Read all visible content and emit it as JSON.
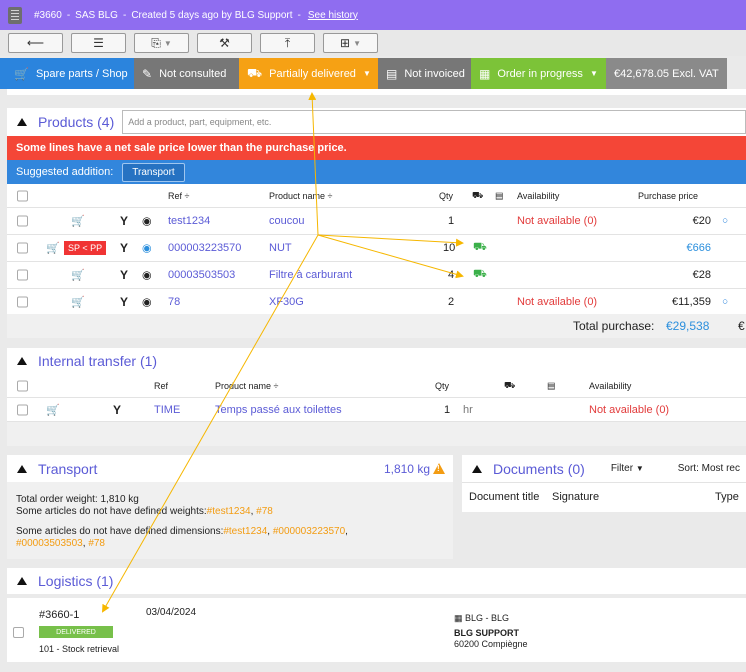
{
  "titlebar": {
    "order_id": "#3660",
    "company": "SAS BLG",
    "created": "Created 5 days ago by BLG Support",
    "history_link": "See history"
  },
  "toolbar": {
    "buttons": [
      "back-arrow",
      "list",
      "export",
      "tools",
      "upload",
      "tree"
    ]
  },
  "status": {
    "shop": "Spare parts / Shop",
    "consulted": "Not consulted",
    "delivery": "Partially delivered",
    "invoiced": "Not invoiced",
    "order_state": "Order in progress",
    "amount": "€42,678.05 Excl. VAT"
  },
  "colors": {
    "title_bar": "#8f6df0",
    "status_blue": "#2b84dd",
    "status_orange": "#f6a114",
    "status_green": "#7cc338",
    "warning_red": "#f44637",
    "link": "#5b5bd6",
    "annotation_arrow": "#f6b700"
  },
  "products": {
    "title": "Products (4)",
    "search_placeholder": "Add a product, part, equipment, etc.",
    "warning": "Some lines have a net sale price lower than the purchase price.",
    "suggested_label": "Suggested addition:",
    "suggested_button": "Transport",
    "columns": {
      "ref": "Ref ÷",
      "name": "Product name ÷",
      "qty": "Qty",
      "availability": "Availability",
      "purchase_price": "Purchase price"
    },
    "rows": [
      {
        "ref": "test1234",
        "name": "coucou",
        "qty": "1",
        "availability": "Not available (0)",
        "price": "€20"
      },
      {
        "badge": "SP < PP",
        "ref": "000003223570",
        "name": "NUT",
        "qty": "10",
        "availability": "",
        "price": "€666"
      },
      {
        "ref": "00003503503",
        "name": "Filtre à carburant",
        "qty": "4",
        "availability": "",
        "price": "€28"
      },
      {
        "ref": "78",
        "name": "XF30G",
        "qty": "2",
        "availability": "Not available (0)",
        "price": "€11,359"
      }
    ],
    "total_label": "Total purchase:",
    "total_value": "€29,538",
    "total_trailing": "€"
  },
  "internal_transfer": {
    "title": "Internal transfer (1)",
    "columns": {
      "ref": "Ref",
      "name": "Product name ÷",
      "qty": "Qty",
      "availability": "Availability"
    },
    "rows": [
      {
        "ref": "TIME",
        "name": "Temps passé aux toilettes",
        "qty": "1",
        "unit": "hr",
        "availability": "Not available (0)"
      }
    ]
  },
  "transport": {
    "title": "Transport",
    "weight": "1,810 kg",
    "line1": "Total order weight: 1,810 kg",
    "line2_prefix": "Some articles do not have defined weights:",
    "line2_links": [
      "#test1234",
      "#78"
    ],
    "line3_prefix": "Some articles do not have defined dimensions:",
    "line3_links": [
      "#test1234",
      "#000003223570",
      "#00003503503",
      "#78"
    ]
  },
  "documents": {
    "title": "Documents (0)",
    "filter": "Filter",
    "sort": "Sort: Most rec",
    "col_title": "Document title",
    "col_signature": "Signature",
    "col_type": "Type"
  },
  "logistics": {
    "title": "Logistics (1)",
    "id": "#3660-1",
    "date": "03/04/2024",
    "status": "DELIVERED",
    "location": "101 - Stock retrieval",
    "company": "BLG - BLG",
    "contact": "BLG SUPPORT",
    "city": "60200 Compiègne"
  }
}
